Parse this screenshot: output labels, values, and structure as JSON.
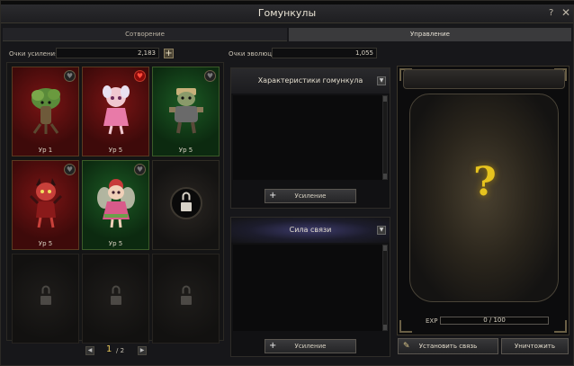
{
  "window": {
    "title": "Гомункулы",
    "help_icon": "?",
    "close_icon": "✕"
  },
  "tabs": [
    {
      "label": "Сотворение",
      "active": false
    },
    {
      "label": "Управление",
      "active": true
    }
  ],
  "stats": {
    "boost_label": "Очки усиления",
    "boost_value": "2,183",
    "boost_add_icon": "+",
    "evolution_label": "Очки эволюции",
    "evolution_value": "1,055"
  },
  "slots": [
    {
      "state": "red",
      "level": "Ур 1",
      "favorite": false,
      "creature": "tree-creature"
    },
    {
      "state": "red",
      "level": "Ур 5",
      "favorite": true,
      "creature": "pink-fairy"
    },
    {
      "state": "green",
      "level": "Ур 5",
      "favorite": false,
      "creature": "armored-goblin"
    },
    {
      "state": "red",
      "level": "Ур 5",
      "favorite": false,
      "creature": "horned-imp"
    },
    {
      "state": "green",
      "level": "Ур 5",
      "favorite": false,
      "creature": "flower-fairy"
    },
    {
      "state": "locked"
    },
    {
      "state": "empty"
    },
    {
      "state": "empty"
    },
    {
      "state": "empty"
    }
  ],
  "pager": {
    "prev_icon": "◀",
    "next_icon": "▶",
    "current": "1",
    "total": "/ 2"
  },
  "characteristics": {
    "title": "Характеристики гомункула",
    "expand_icon": "▼",
    "button": "Усиление",
    "button_icon": "+"
  },
  "bond": {
    "title": "Сила связи",
    "expand_icon": "▼",
    "button": "Усиление",
    "button_icon": "+"
  },
  "jar": {
    "unknown_mark": "?",
    "exp_label": "EXP",
    "exp_text": "0 / 100",
    "exp_fraction": 0
  },
  "actions": {
    "link_label": "Установить связь",
    "link_icon": "✎",
    "destroy_label": "Уничтожить"
  }
}
